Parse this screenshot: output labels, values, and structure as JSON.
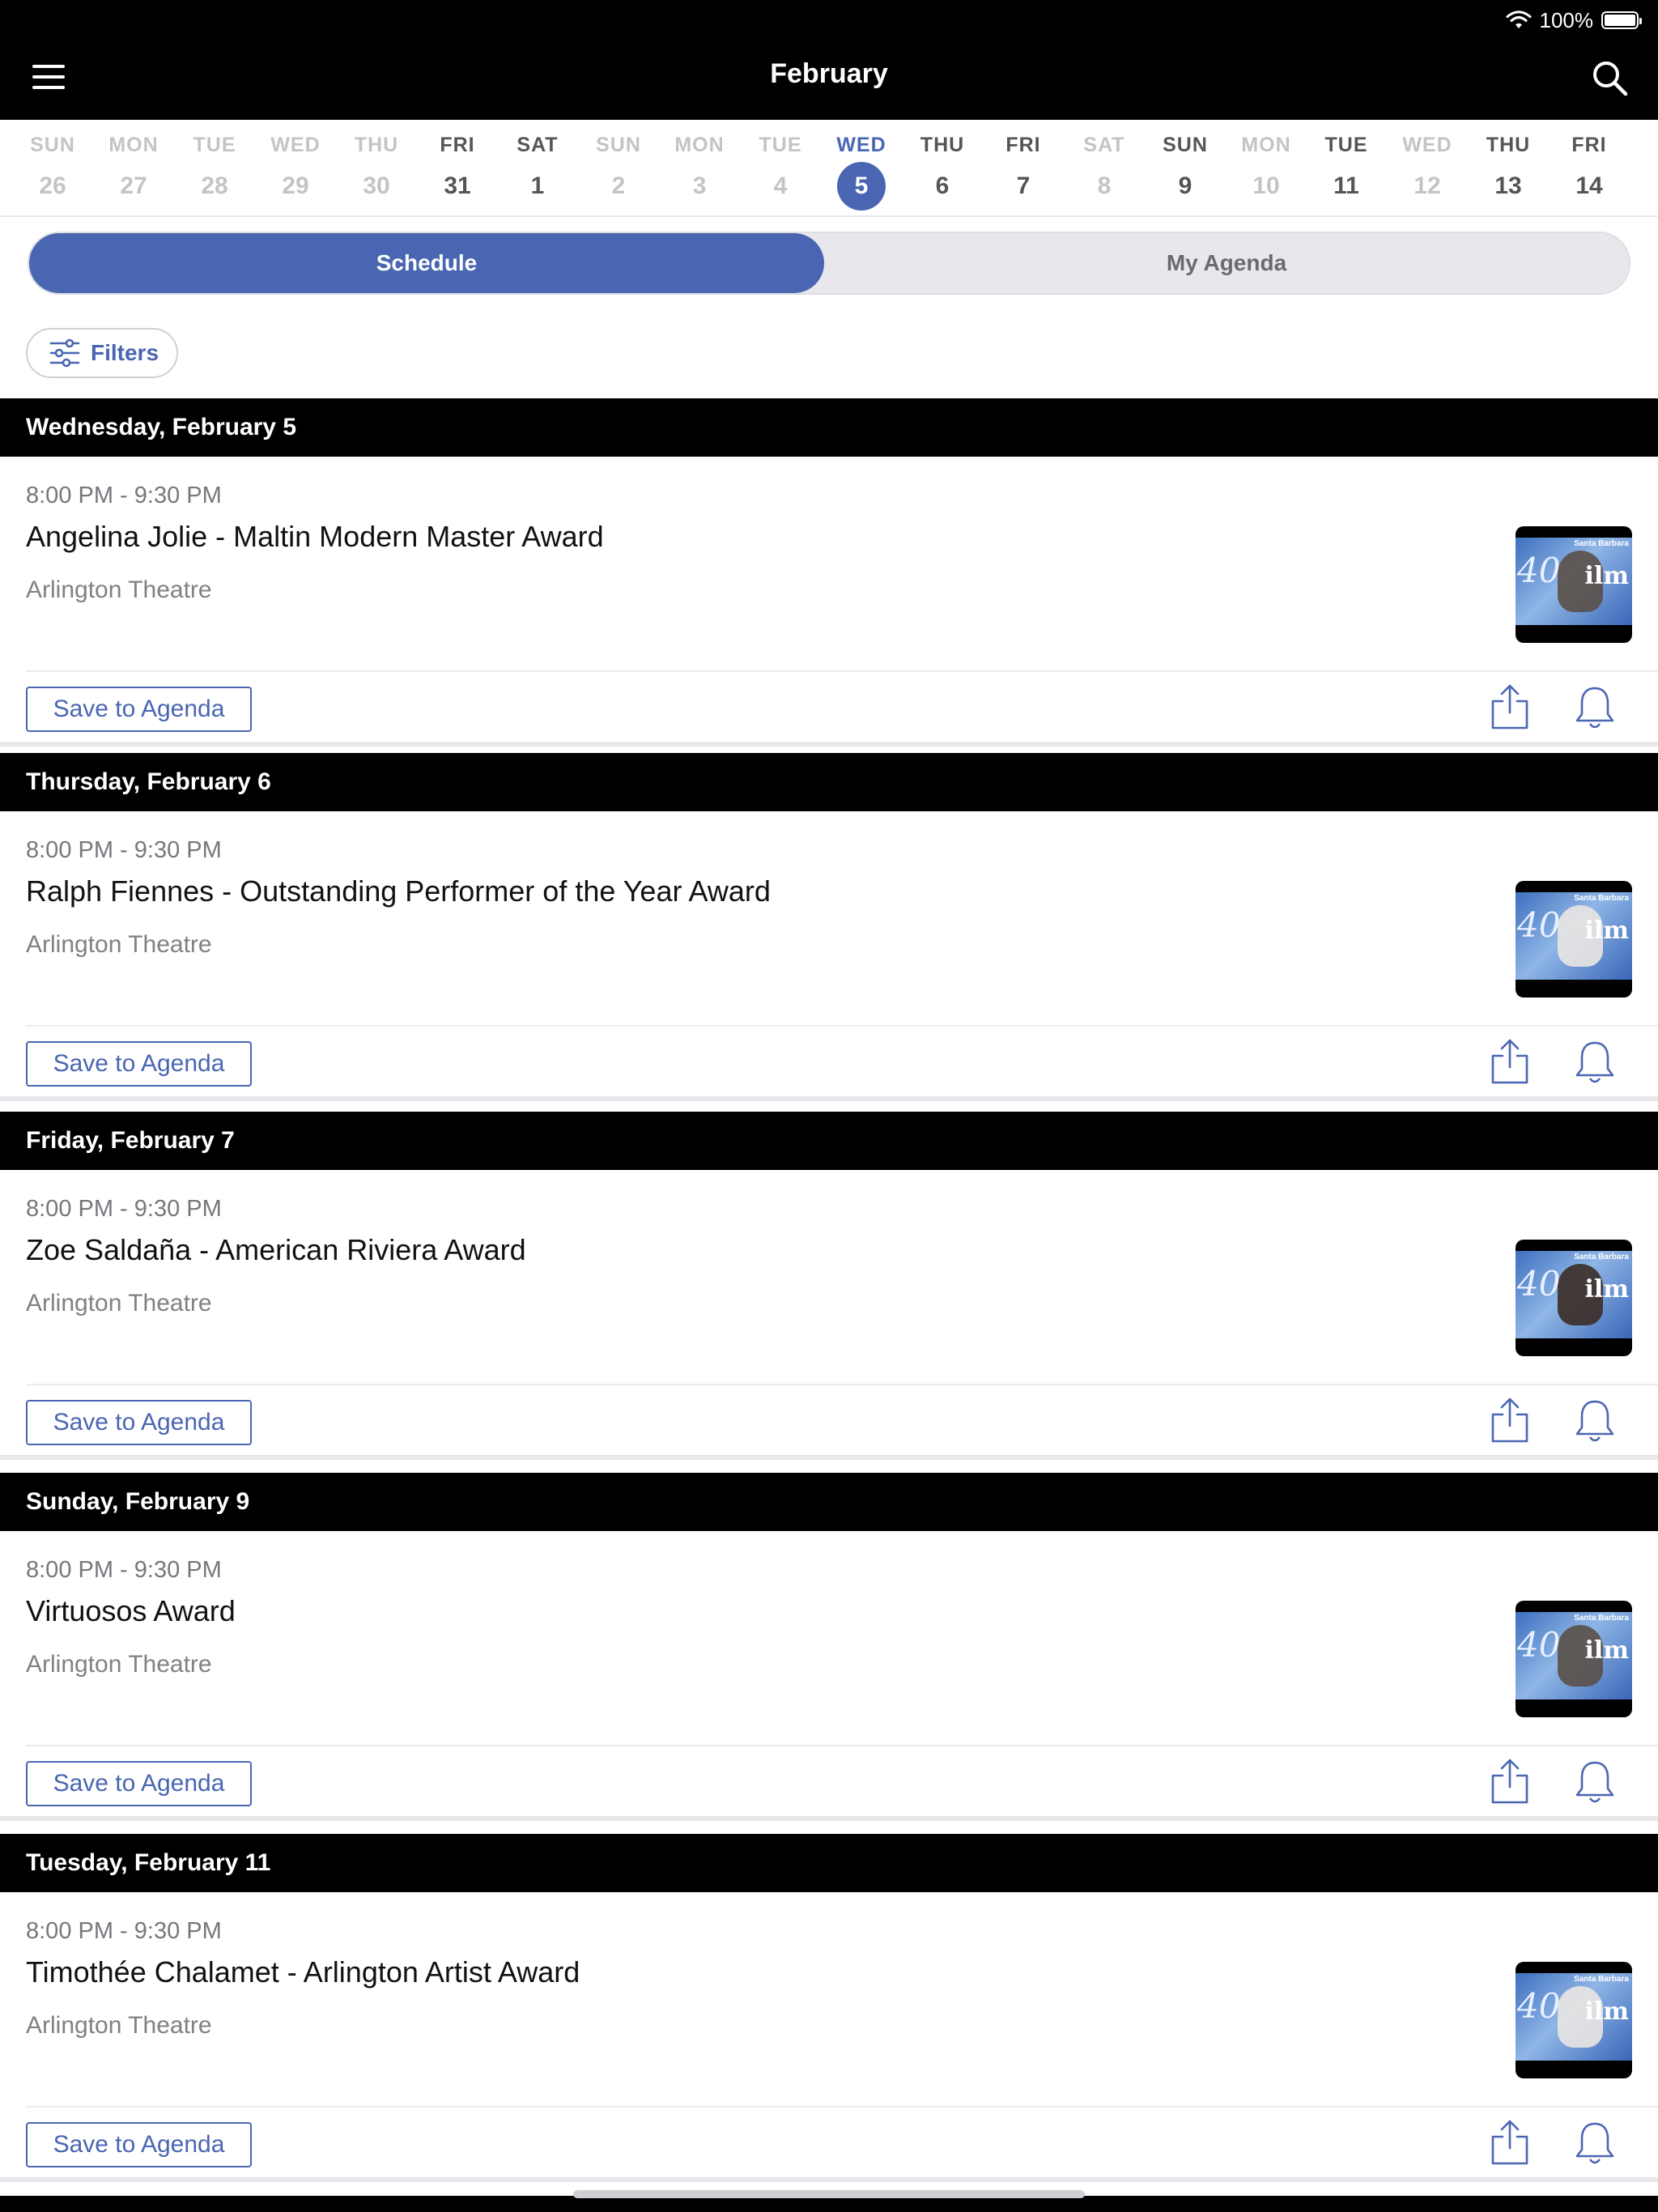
{
  "status": {
    "battery": "100%"
  },
  "header": {
    "title": "February",
    "menu_icon": "hamburger-menu-icon",
    "search_icon": "search-icon"
  },
  "date_strip": [
    {
      "dow": "SUN",
      "num": "26",
      "state": "muted"
    },
    {
      "dow": "MON",
      "num": "27",
      "state": "muted"
    },
    {
      "dow": "TUE",
      "num": "28",
      "state": "muted"
    },
    {
      "dow": "WED",
      "num": "29",
      "state": "muted"
    },
    {
      "dow": "THU",
      "num": "30",
      "state": "muted"
    },
    {
      "dow": "FRI",
      "num": "31",
      "state": "active"
    },
    {
      "dow": "SAT",
      "num": "1",
      "state": "active"
    },
    {
      "dow": "SUN",
      "num": "2",
      "state": "muted"
    },
    {
      "dow": "MON",
      "num": "3",
      "state": "muted"
    },
    {
      "dow": "TUE",
      "num": "4",
      "state": "muted"
    },
    {
      "dow": "WED",
      "num": "5",
      "state": "selected"
    },
    {
      "dow": "THU",
      "num": "6",
      "state": "active"
    },
    {
      "dow": "FRI",
      "num": "7",
      "state": "active"
    },
    {
      "dow": "SAT",
      "num": "8",
      "state": "muted"
    },
    {
      "dow": "SUN",
      "num": "9",
      "state": "active"
    },
    {
      "dow": "MON",
      "num": "10",
      "state": "muted"
    },
    {
      "dow": "TUE",
      "num": "11",
      "state": "active"
    },
    {
      "dow": "WED",
      "num": "12",
      "state": "muted"
    },
    {
      "dow": "THU",
      "num": "13",
      "state": "active"
    },
    {
      "dow": "FRI",
      "num": "14",
      "state": "active"
    }
  ],
  "tabs": {
    "schedule": "Schedule",
    "my_agenda": "My Agenda"
  },
  "filters": {
    "label": "Filters"
  },
  "sections": [
    {
      "day": "Wednesday, February 5",
      "time": "8:00 PM - 9:30 PM",
      "title": "Angelina Jolie - Maltin Modern Master Award",
      "venue": "Arlington Theatre",
      "save_label": "Save to Agenda"
    },
    {
      "day": "Thursday, February 6",
      "time": "8:00 PM - 9:30 PM",
      "title": "Ralph Fiennes - Outstanding Performer of the Year Award",
      "venue": "Arlington Theatre",
      "save_label": "Save to Agenda"
    },
    {
      "day": "Friday, February 7",
      "time": "8:00 PM - 9:30 PM",
      "title": "Zoe Saldaña - American Riviera Award",
      "venue": "Arlington Theatre",
      "save_label": "Save to Agenda"
    },
    {
      "day": "Sunday, February 9",
      "time": "8:00 PM - 9:30 PM",
      "title": "Virtuosos Award",
      "venue": "Arlington Theatre",
      "save_label": "Save to Agenda"
    },
    {
      "day": "Tuesday, February 11",
      "time": "8:00 PM - 9:30 PM",
      "title": "Timothée Chalamet - Arlington Artist Award",
      "venue": "Arlington Theatre",
      "save_label": "Save to Agenda"
    }
  ],
  "thumbnail": {
    "number": "40",
    "word": "ilm",
    "banner": "Santa Barbara"
  },
  "colors": {
    "accent": "#4a66b3",
    "header_bg": "#000000",
    "muted_text": "#c4c4c8",
    "segment_bg": "#e8e8ec"
  }
}
